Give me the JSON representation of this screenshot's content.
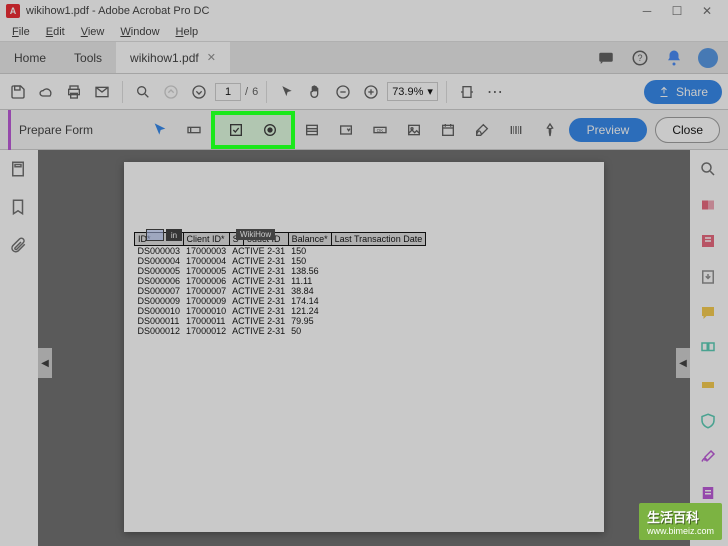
{
  "window": {
    "title": "wikihow1.pdf - Adobe Acrobat Pro DC",
    "app_icon_glyph": "A"
  },
  "menubar": [
    "File",
    "Edit",
    "View",
    "Window",
    "Help"
  ],
  "tabs": {
    "home": "Home",
    "tools": "Tools",
    "active": "wikihow1.pdf"
  },
  "toolbar": {
    "page_current": "1",
    "page_total": "6",
    "zoom": "73.9%",
    "share_label": "Share"
  },
  "formbar": {
    "title": "Prepare Form",
    "preview_label": "Preview",
    "close_label": "Close"
  },
  "table": {
    "headers": [
      "ID*",
      "Client ID*",
      "S",
      "oduct ID",
      "Balance*",
      "Last Transaction Date"
    ],
    "overlay_in": "in",
    "overlay_tip": "WikiHow",
    "rows": [
      [
        "DS000003",
        "17000003",
        "ACTIVE 2-31",
        "150"
      ],
      [
        "DS000004",
        "17000004",
        "ACTIVE 2-31",
        "150"
      ],
      [
        "DS000005",
        "17000005",
        "ACTIVE 2-31",
        "138.56"
      ],
      [
        "DS000006",
        "17000006",
        "ACTIVE 2-31",
        "11.11"
      ],
      [
        "DS000007",
        "17000007",
        "ACTIVE 2-31",
        "38.84"
      ],
      [
        "DS000009",
        "17000009",
        "ACTIVE 2-31",
        "174.14"
      ],
      [
        "DS000010",
        "17000010",
        "ACTIVE 2-31",
        "121.24"
      ],
      [
        "DS000011",
        "17000011",
        "ACTIVE 2-31",
        "79.95"
      ],
      [
        "DS000012",
        "17000012",
        "ACTIVE 2-31",
        "50"
      ]
    ]
  },
  "watermark": {
    "main": "生活百科",
    "sub": "www.bimeiz.com"
  }
}
